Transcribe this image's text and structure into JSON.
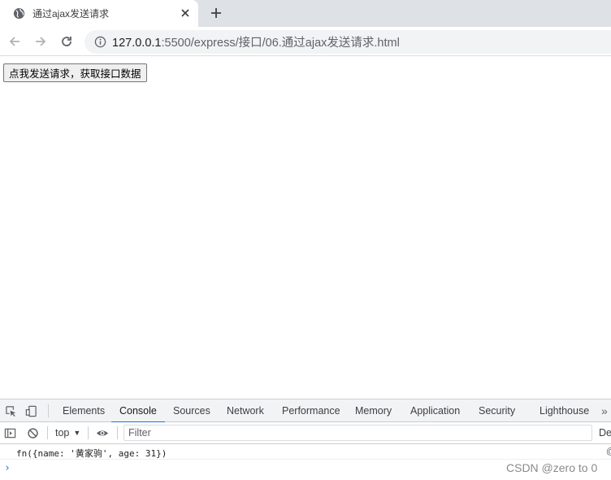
{
  "browser": {
    "tab": {
      "title": "通过ajax发送请求",
      "favicon": "globe-icon",
      "close": "close-icon"
    },
    "new_tab": "plus-icon",
    "url": {
      "host": "127.0.0.1",
      "path": ":5500/express/接口/06.通过ajax发送请求.html"
    }
  },
  "page": {
    "button_label": "点我发送请求，获取接口数据"
  },
  "devtools": {
    "tabs": [
      "Elements",
      "Console",
      "Sources",
      "Network",
      "Performance",
      "Memory",
      "Application",
      "Security",
      "Lighthouse"
    ],
    "active_tab": "Console",
    "more": "»",
    "context": "top",
    "context_arrow": "▼",
    "filter_placeholder": "Filter",
    "levels_label": "De",
    "log": {
      "text": "fn({name: '黄家驹', age: 31})",
      "source": "@"
    },
    "prompt": "›"
  },
  "watermark": "CSDN @zero to 0",
  "colors": {
    "accent": "#1a73e8",
    "tabstrip": "#dee1e6",
    "omnibox": "#f1f3f4"
  }
}
